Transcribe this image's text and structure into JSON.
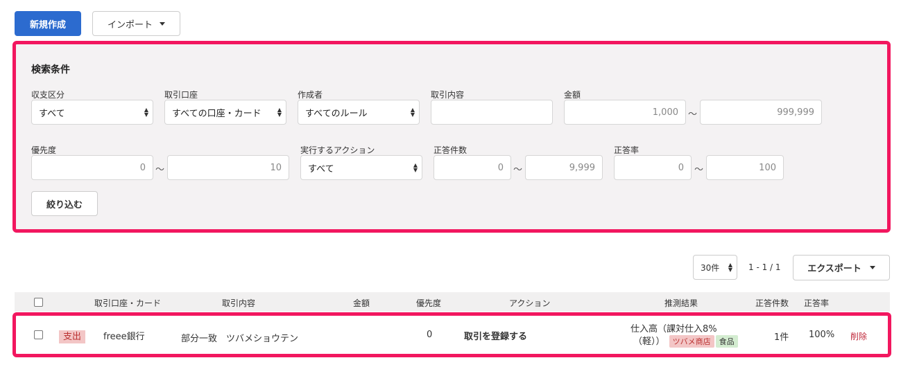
{
  "toolbar": {
    "new_label": "新規作成",
    "import_label": "インポート"
  },
  "search": {
    "title": "検索条件",
    "type": {
      "label": "収支区分",
      "value": "すべて"
    },
    "account": {
      "label": "取引口座",
      "value": "すべての口座・カード"
    },
    "creator": {
      "label": "作成者",
      "value": "すべてのルール"
    },
    "content": {
      "label": "取引内容",
      "value": ""
    },
    "amount": {
      "label": "金額",
      "min": "1,000",
      "max": "999,999"
    },
    "priority": {
      "label": "優先度",
      "min": "0",
      "max": "10"
    },
    "action": {
      "label": "実行するアクション",
      "value": "すべて"
    },
    "correct_count": {
      "label": "正答件数",
      "min": "0",
      "max": "9,999"
    },
    "correct_rate": {
      "label": "正答率",
      "min": "0",
      "max": "100"
    },
    "tilde": "～",
    "filter_label": "絞り込む"
  },
  "list": {
    "per_page": "30件",
    "range": "1 - 1 / 1",
    "export_label": "エクスポート",
    "headers": [
      "取引口座・カード",
      "取引内容",
      "金額",
      "優先度",
      "アクション",
      "推測結果",
      "正答件数",
      "正答率"
    ],
    "rows": [
      {
        "type": "支出",
        "account": "freee銀行",
        "content": "部分一致　ツバメショウテン",
        "amount": "",
        "priority": "0",
        "action": "取引を登録する",
        "result_line1": "仕入高（課対仕入8%",
        "result_line2": "（軽））",
        "tag_partner": "ツバメ商店",
        "tag_item": "食品",
        "correct_count": "1件",
        "correct_rate": "100%",
        "delete_label": "削除"
      }
    ]
  }
}
